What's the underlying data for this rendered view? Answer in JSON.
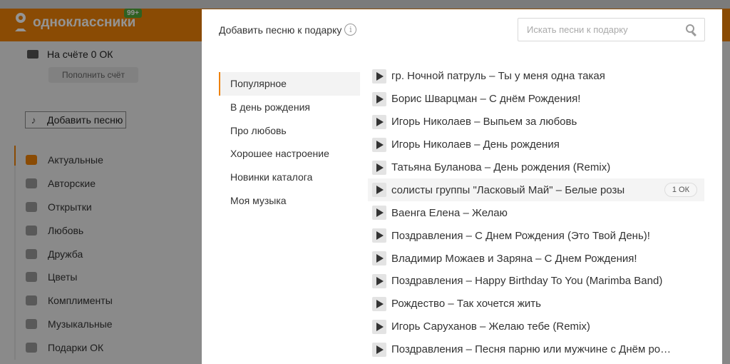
{
  "background": {
    "logo_text": "одноклассники",
    "logo_badge": "99+",
    "balance_text": "На счёте 0 ОК",
    "topup_label": "Пополнить счёт",
    "add_song_label": "Добавить песню",
    "categories": [
      {
        "label": "Актуальные",
        "icon": "fire-icon"
      },
      {
        "label": "Авторские",
        "icon": "star-person-icon"
      },
      {
        "label": "Открытки",
        "icon": "postcard-icon"
      },
      {
        "label": "Любовь",
        "icon": "hearts-icon"
      },
      {
        "label": "Дружба",
        "icon": "friends-icon"
      },
      {
        "label": "Цветы",
        "icon": "flower-icon"
      },
      {
        "label": "Комплименты",
        "icon": "compliment-icon"
      },
      {
        "label": "Музыкальные",
        "icon": "music-note-icon"
      },
      {
        "label": "Подарки ОК",
        "icon": "gift-icon"
      }
    ]
  },
  "modal": {
    "title": "Добавить песню к подарку",
    "info_glyph": "i",
    "search_placeholder": "Искать песни к подарку",
    "categories": [
      {
        "label": "Популярное",
        "selected": true
      },
      {
        "label": "В день рождения",
        "selected": false
      },
      {
        "label": "Про любовь",
        "selected": false
      },
      {
        "label": "Хорошее настроение",
        "selected": false
      },
      {
        "label": "Новинки каталога",
        "selected": false
      },
      {
        "label": "Моя музыка",
        "selected": false
      }
    ],
    "songs": [
      {
        "title": "гр. Ночной патруль – Ты у меня одна такая"
      },
      {
        "title": "Борис Шварцман – С днём Рождения!"
      },
      {
        "title": "Игорь Николаев – Выпьем за любовь"
      },
      {
        "title": "Игорь Николаев – День рождения"
      },
      {
        "title": "Татьяна Буланова – День рождения (Remix)"
      },
      {
        "title": "солисты группы \"Ласковый Май\" – Белые розы",
        "price": "1 ОК",
        "hovered": true
      },
      {
        "title": "Ваенга Елена – Желаю"
      },
      {
        "title": "Поздравления – С Днем Рождения (Это Твой День)!"
      },
      {
        "title": "Владимир Можаев и Заряна – С Днем Рождения!"
      },
      {
        "title": "Поздравления – Happy Birthday To You (Marimba Band)"
      },
      {
        "title": "Рождество – Так хочется жить"
      },
      {
        "title": "Игорь Саруханов – Желаю тебе (Remix)"
      },
      {
        "title": "Поздравления – Песня парню или мужчине с Днём ро…"
      }
    ]
  },
  "colors": {
    "brand_orange": "#ee8208",
    "badge_green": "#52a83a",
    "overlay": "rgba(0,0,0,0.42)"
  }
}
